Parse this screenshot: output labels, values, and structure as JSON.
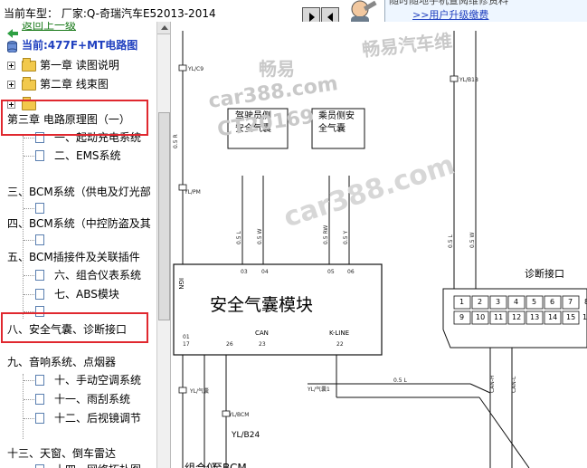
{
  "topbar": {
    "vehicle_label": "当前车型：  厂家:Q-奇瑞汽车E52013-2014",
    "upgrade_notice": "随时随地手机查阅维修资料",
    "upgrade_link": ">>用户升级缴费"
  },
  "sidebar": {
    "back_link": "返回上一级",
    "current_model": "当前:477F+MT电路图",
    "items": [
      {
        "label": "第一章 读图说明"
      },
      {
        "label": "第二章 线束图"
      },
      {
        "label": ""
      },
      {
        "label": "第三章 电路原理图（一）"
      },
      {
        "label": "一、起动充电系统"
      },
      {
        "label": "二、EMS系统"
      },
      {
        "label": "三、BCM系统（供电及灯光部"
      },
      {
        "label": ""
      },
      {
        "label": "四、BCM系统（中控防盗及其"
      },
      {
        "label": ""
      },
      {
        "label": "五、BCM插接件及关联插件"
      },
      {
        "label": "六、组合仪表系统"
      },
      {
        "label": "七、ABS模块"
      },
      {
        "label": ""
      },
      {
        "label": "八、安全气囊、诊断接口"
      },
      {
        "label": "九、音响系统、点烟器"
      },
      {
        "label": "十、手动空调系统"
      },
      {
        "label": "十一、雨刮系统"
      },
      {
        "label": "十二、后视镜调节"
      },
      {
        "label": "十三、天窗、倒车雷达"
      },
      {
        "label": "十四、网络拓扑图"
      }
    ]
  },
  "diagram": {
    "watermarks": [
      "畅易",
      "car388.com",
      "CT20169",
      "畅易汽车维",
      "car388.com"
    ],
    "airbag_module": "安全气囊模块",
    "driver_airbag": [
      "驾驶员侧",
      "安全气囊"
    ],
    "passenger_airbag": [
      "乘员侧安",
      "全气囊"
    ],
    "diag_port": "诊断接口",
    "module_pins": [
      "IGN",
      "CAN",
      "K-LINE"
    ],
    "pin_numbers": [
      "01",
      "03",
      "04",
      "05",
      "06",
      "17",
      "26",
      "23",
      "22"
    ],
    "connector_labels": [
      "YL/C9",
      "YL/B18",
      "YL/B24"
    ],
    "port_pins_top": [
      "1",
      "2",
      "3",
      "4",
      "5",
      "6",
      "7",
      "8"
    ],
    "port_pins_bottom": [
      "9",
      "10",
      "11",
      "12",
      "13",
      "14",
      "15",
      "16"
    ],
    "wire_labels": [
      "CAN-H",
      "CAN-L",
      "0.5 L",
      "0.5 R",
      "0.5 W"
    ],
    "bottom_labels": [
      "组合仪",
      "至BCM"
    ]
  }
}
